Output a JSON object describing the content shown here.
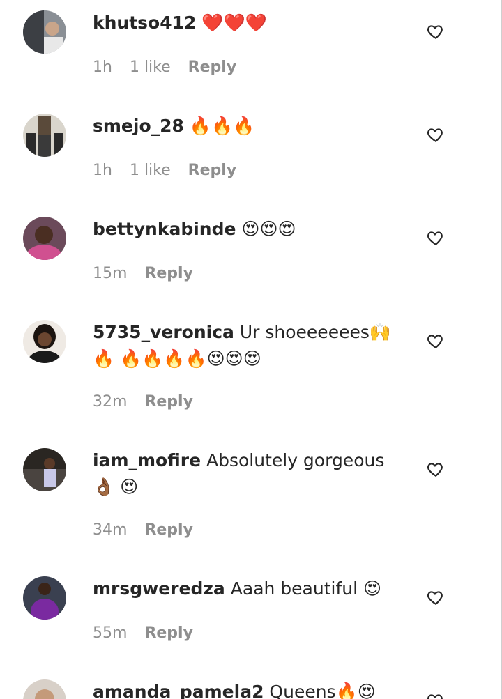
{
  "comments": [
    {
      "username": "khutso412",
      "text": "",
      "emojis": "❤️❤️❤️",
      "time": "1h",
      "likes": "1 like",
      "reply": "Reply",
      "avatar": "avatar-car"
    },
    {
      "username": "smejo_28",
      "text": "",
      "emojis": "🔥🔥🔥",
      "time": "1h",
      "likes": "1 like",
      "reply": "Reply",
      "avatar": "avatar-group"
    },
    {
      "username": "bettynkabinde",
      "text": "",
      "emojis": "😍😍😍",
      "time": "15m",
      "likes": "",
      "reply": "Reply",
      "avatar": "avatar-woman-pink"
    },
    {
      "username": "5735_veronica",
      "text": "Ur shoeeeeees",
      "emojis": "🙌🔥 🔥🔥🔥🔥😍😍😍",
      "time": "32m",
      "likes": "",
      "reply": "Reply",
      "avatar": "avatar-woman-dark"
    },
    {
      "username": "iam_mofire",
      "text": "Absolutely gorgeous",
      "emojis": "👌🏾 😍",
      "time": "34m",
      "likes": "",
      "reply": "Reply",
      "avatar": "avatar-woman-car"
    },
    {
      "username": "mrsgweredza",
      "text": "Aaah beautiful",
      "emojis": "😍",
      "time": "55m",
      "likes": "",
      "reply": "Reply",
      "avatar": "avatar-woman-purple"
    },
    {
      "username": "amanda_pamela2",
      "text": "Queens",
      "emojis": "🔥😍",
      "time": "",
      "likes": "",
      "reply": "",
      "avatar": "avatar-woman-light"
    }
  ]
}
